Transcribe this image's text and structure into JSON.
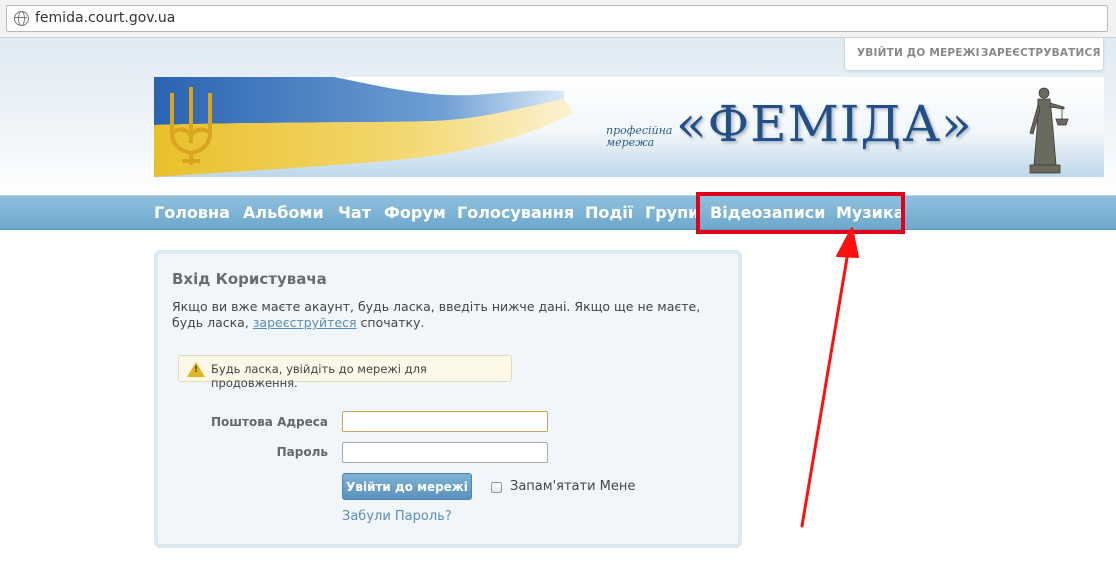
{
  "browser": {
    "url": "femida.court.gov.ua"
  },
  "header": {
    "login_link": "УВІЙТИ ДО МЕРЕЖІ",
    "register_link": "ЗАРЕЄСТРУВАТИСЯ"
  },
  "banner": {
    "subtitle_line1": "професійна",
    "subtitle_line2": "мережа",
    "title": "«ФЕМІДА»"
  },
  "nav": {
    "items": [
      {
        "label": "Головна"
      },
      {
        "label": "Альбоми"
      },
      {
        "label": "Чат"
      },
      {
        "label": "Форум"
      },
      {
        "label": "Голосування"
      },
      {
        "label": "Події"
      },
      {
        "label": "Групи"
      },
      {
        "label": "Відеозаписи"
      },
      {
        "label": "Музика"
      }
    ]
  },
  "login": {
    "title": "Вхід Користувача",
    "intro_before": "Якщо ви вже маєте акаунт, будь ласка, введіть нижче дані. Якщо ще не маєте, будь ласка, ",
    "intro_link": "зареєструйтеся",
    "intro_after": " спочатку.",
    "notice": "Будь ласка, увійдіть до мережі для продовження.",
    "email_label": "Поштова Адреса",
    "email_value": "",
    "password_label": "Пароль",
    "password_value": "",
    "submit_label": "Увійти до мережі",
    "remember_label": "Запам'ятати Мене",
    "remember_checked": false,
    "forgot_link": "Забули Пароль?"
  },
  "colors": {
    "nav_bg": "#7fb4d6",
    "highlight": "#e0001a",
    "link": "#5b8db8",
    "banner_title": "#234f85"
  }
}
